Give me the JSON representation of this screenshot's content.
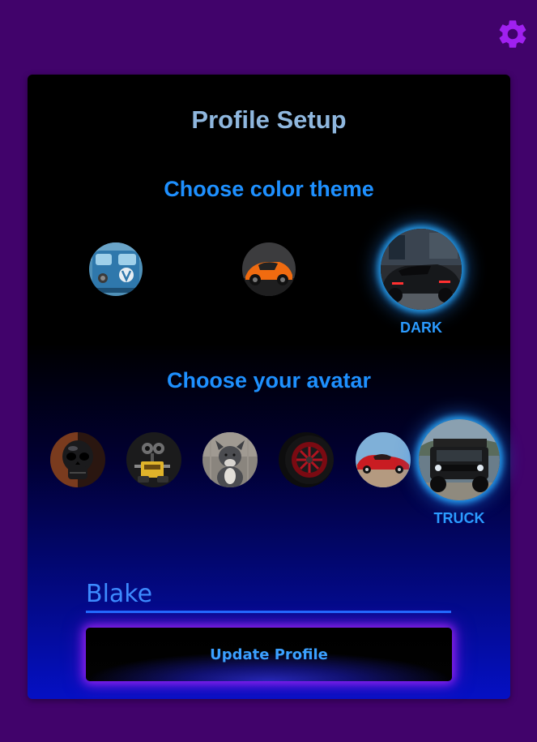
{
  "header": {
    "settings_icon": "gear-icon",
    "settings_color": "#a020f0"
  },
  "card": {
    "title": "Profile Setup",
    "theme_section": {
      "heading": "Choose color theme",
      "options": [
        {
          "image": "blue-vw-bus-thumbnail",
          "selected": false,
          "label": ""
        },
        {
          "image": "orange-sports-car-thumbnail",
          "selected": false,
          "label": ""
        },
        {
          "image": "dark-sports-car-thumbnail",
          "selected": true,
          "label": "DARK"
        }
      ]
    },
    "avatar_section": {
      "heading": "Choose your avatar",
      "options": [
        {
          "image": "skull-thumbnail",
          "selected": false,
          "label": ""
        },
        {
          "image": "robot-thumbnail",
          "selected": false,
          "label": ""
        },
        {
          "image": "dog-thumbnail",
          "selected": false,
          "label": ""
        },
        {
          "image": "red-wheel-thumbnail",
          "selected": false,
          "label": ""
        },
        {
          "image": "red-classic-car-thumbnail",
          "selected": false,
          "label": ""
        },
        {
          "image": "black-truck-thumbnail",
          "selected": true,
          "label": "TRUCK"
        }
      ]
    },
    "name_input": {
      "value": "Blake"
    },
    "update_button": {
      "label": "Update Profile"
    }
  },
  "colors": {
    "accent": "#1e90ff",
    "background": "#41036b",
    "button_glow": "#aa28ff"
  }
}
